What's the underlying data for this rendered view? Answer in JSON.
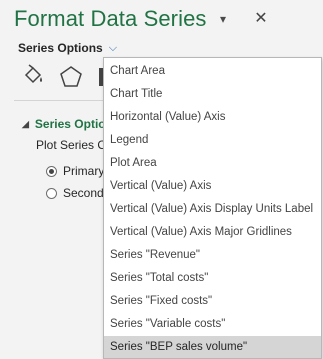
{
  "pane": {
    "title": "Format Data Series",
    "close_label": "✕",
    "options_label": "Series Options",
    "options_chevron": "⌵",
    "tabs": [
      {
        "name": "fill-line",
        "icon": "paint-bucket-icon"
      },
      {
        "name": "effects",
        "icon": "pentagon-icon"
      },
      {
        "name": "series-options",
        "icon": "bar-chart-icon"
      }
    ],
    "section_title": "Series Options",
    "plot_on_label": "Plot Series On",
    "radios": [
      {
        "label": "Primary Axis",
        "checked": true
      },
      {
        "label": "Secondary Axis",
        "checked": false
      }
    ]
  },
  "dropdown": {
    "items": [
      "Chart Area",
      "Chart Title",
      "Horizontal (Value) Axis",
      "Legend",
      "Plot Area",
      "Vertical (Value) Axis",
      "Vertical (Value) Axis Display Units Label",
      "Vertical (Value) Axis Major Gridlines",
      "Series \"Revenue\"",
      "Series \"Total costs\"",
      "Series \"Fixed costs\"",
      "Series \"Variable costs\"",
      "Series \"BEP sales volume\""
    ],
    "selected_index": 12
  },
  "colors": {
    "accent": "#217346",
    "selected_bg": "#d5d5d5"
  }
}
